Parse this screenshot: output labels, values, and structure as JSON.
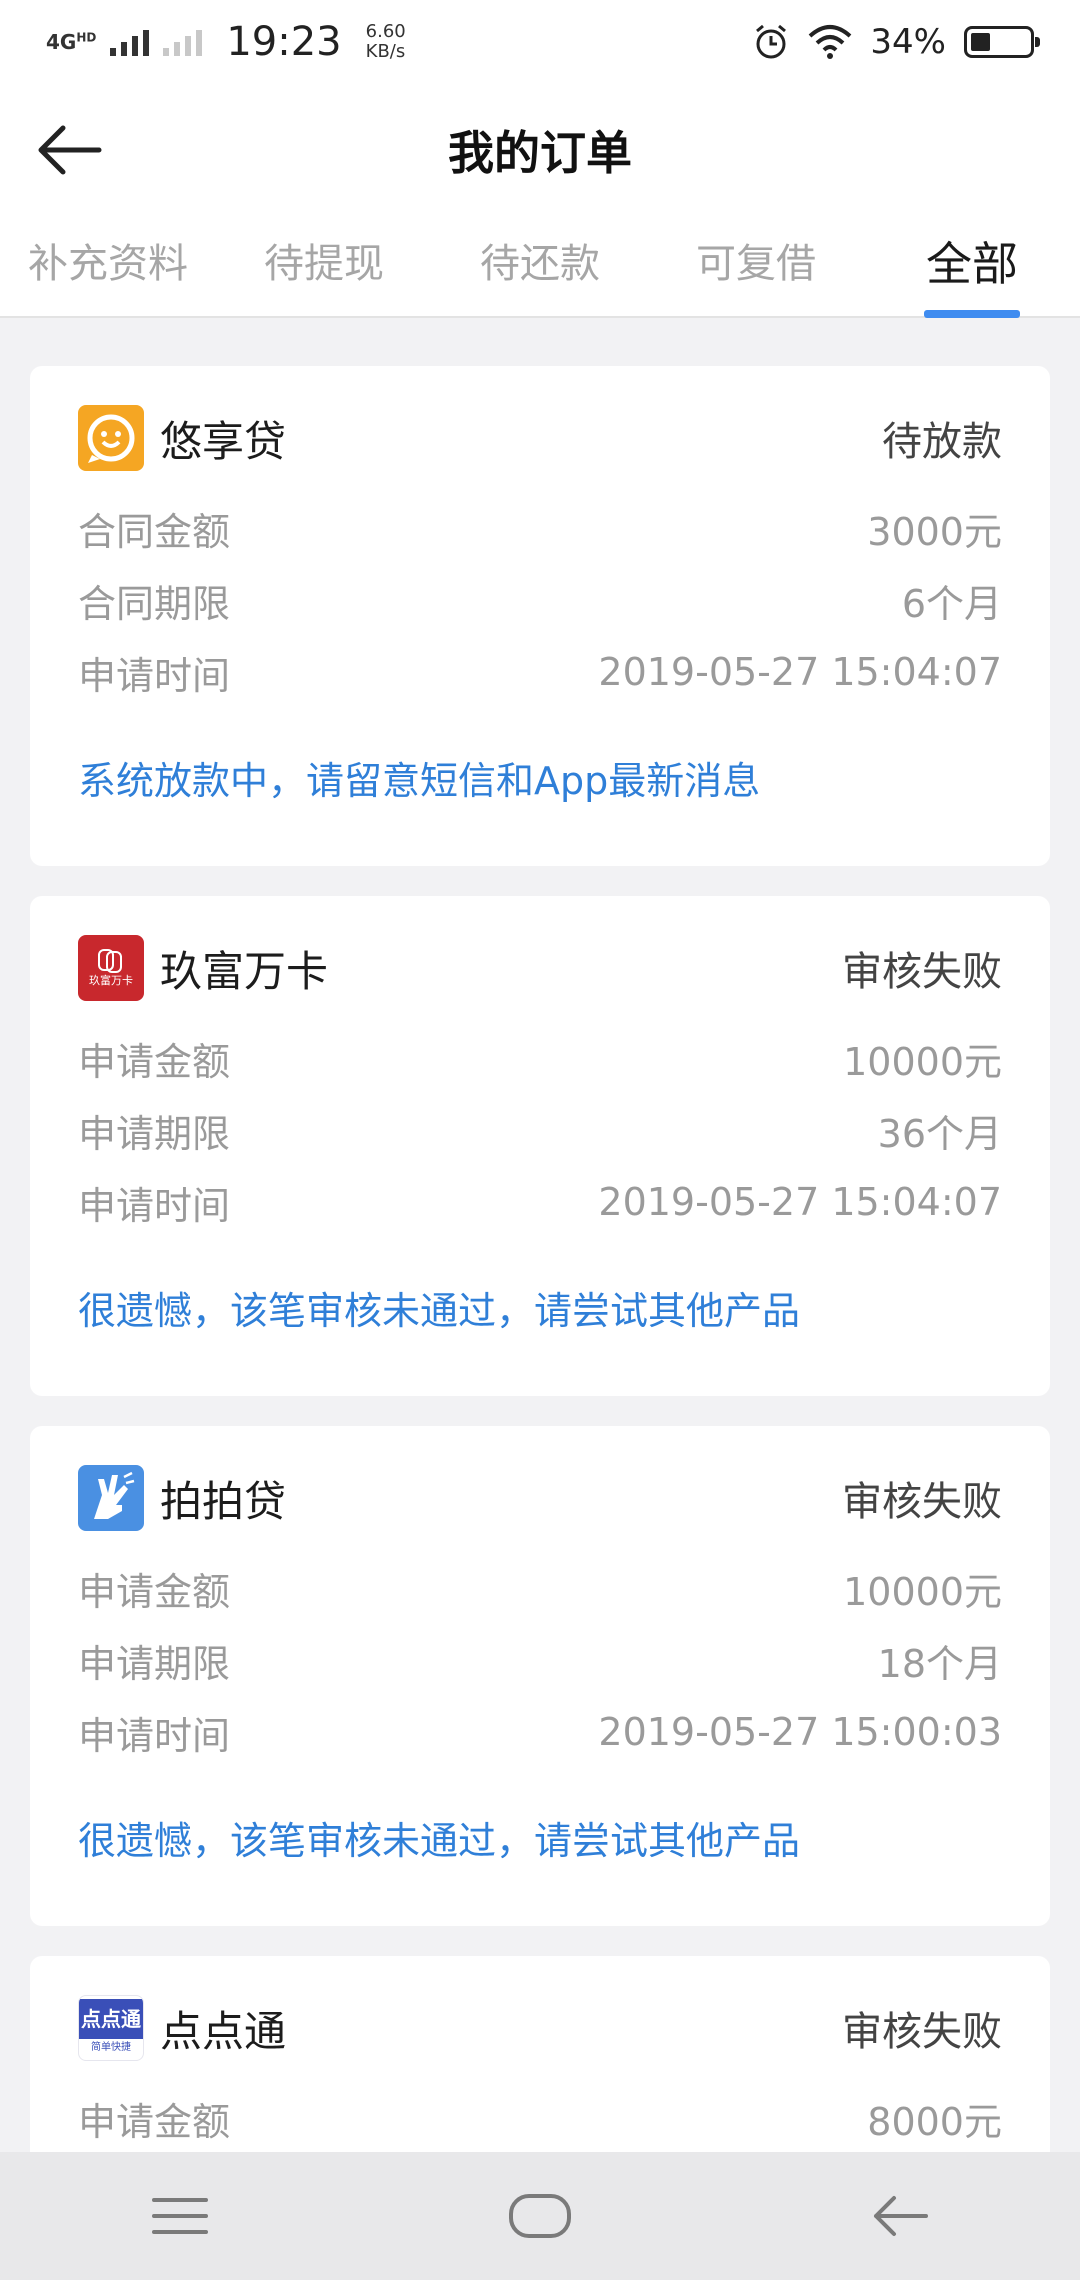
{
  "status_bar": {
    "network": "4G",
    "network_sup": "HD",
    "time": "19:23",
    "speed_value": "6.60",
    "speed_unit": "KB/s",
    "battery_percent": "34%",
    "battery_level": 0.34
  },
  "header": {
    "title": "我的订单"
  },
  "tabs": [
    {
      "label": "补充资料",
      "active": false
    },
    {
      "label": "待提现",
      "active": false
    },
    {
      "label": "待还款",
      "active": false
    },
    {
      "label": "可复借",
      "active": false
    },
    {
      "label": "全部",
      "active": true
    }
  ],
  "orders": [
    {
      "name": "悠享贷",
      "status": "待放款",
      "logo_icon": "smile-logo-icon",
      "logo_color": "#f5a623",
      "rows": [
        {
          "label": "合同金额",
          "value": "3000元"
        },
        {
          "label": "合同期限",
          "value": "6个月"
        },
        {
          "label": "申请时间",
          "value": "2019-05-27 15:04:07"
        }
      ],
      "note": "系统放款中，请留意短信和App最新消息"
    },
    {
      "name": "玖富万卡",
      "status": "审核失败",
      "logo_icon": "card-logo-icon",
      "logo_color": "#c8282d",
      "logo_text": "玖富万卡",
      "rows": [
        {
          "label": "申请金额",
          "value": "10000元"
        },
        {
          "label": "申请期限",
          "value": "36个月"
        },
        {
          "label": "申请时间",
          "value": "2019-05-27 15:04:07"
        }
      ],
      "note": "很遗憾，该笔审核未通过，请尝试其他产品"
    },
    {
      "name": "拍拍贷",
      "status": "审核失败",
      "logo_icon": "hand-logo-icon",
      "logo_color": "#4a90e2",
      "rows": [
        {
          "label": "申请金额",
          "value": "10000元"
        },
        {
          "label": "申请期限",
          "value": "18个月"
        },
        {
          "label": "申请时间",
          "value": "2019-05-27 15:00:03"
        }
      ],
      "note": "很遗憾，该笔审核未通过，请尝试其他产品"
    },
    {
      "name": "点点通",
      "status": "审核失败",
      "logo_icon": "diandiantong-logo-icon",
      "logo_color": "#3a4fb8",
      "logo_text": "点点通",
      "logo_subtext": "简单快捷",
      "rows": [
        {
          "label": "申请金额",
          "value": "8000元"
        }
      ]
    }
  ],
  "colors": {
    "accent": "#3f8cf0",
    "note_text": "#2f7fd8",
    "background": "#f2f2f4"
  }
}
